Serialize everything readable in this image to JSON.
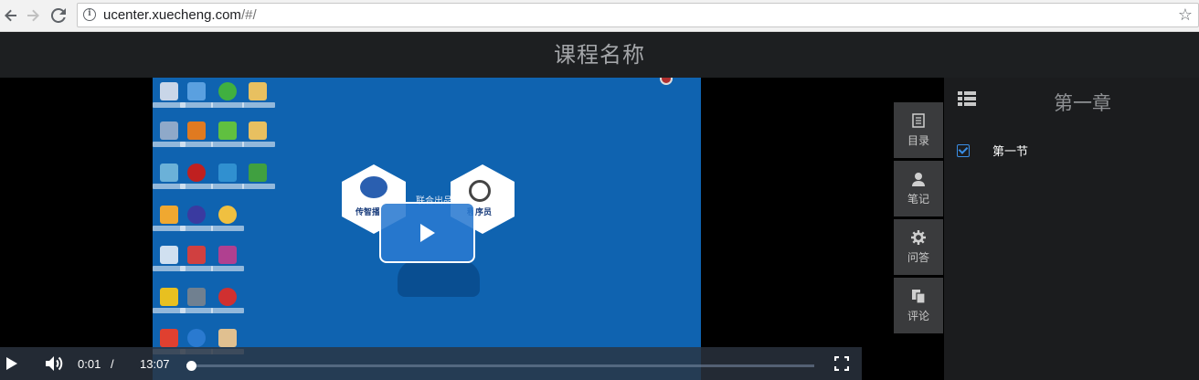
{
  "browser": {
    "url_host": "ucenter.xuecheng.com",
    "url_path": "/#/"
  },
  "page": {
    "title": "课程名称"
  },
  "player": {
    "current_time": "0:01",
    "separator": "/",
    "duration": "13:07",
    "progress_fraction": 0.001,
    "video_logo_left": "传智播",
    "video_logo_right": "程序员",
    "video_center_text": "联合出品"
  },
  "side_tabs": [
    {
      "label": "目录",
      "icon": "catalog-icon"
    },
    {
      "label": "笔记",
      "icon": "person-icon"
    },
    {
      "label": "问答",
      "icon": "gear-icon"
    },
    {
      "label": "评论",
      "icon": "copy-icon"
    }
  ],
  "chapter": {
    "title": "第一章",
    "sections": [
      {
        "label": "第一节",
        "checked": true
      }
    ]
  },
  "colors": {
    "accent": "#3a8ee6",
    "video_bg": "#0f63b0",
    "panel_bg": "#1b1c1e"
  }
}
